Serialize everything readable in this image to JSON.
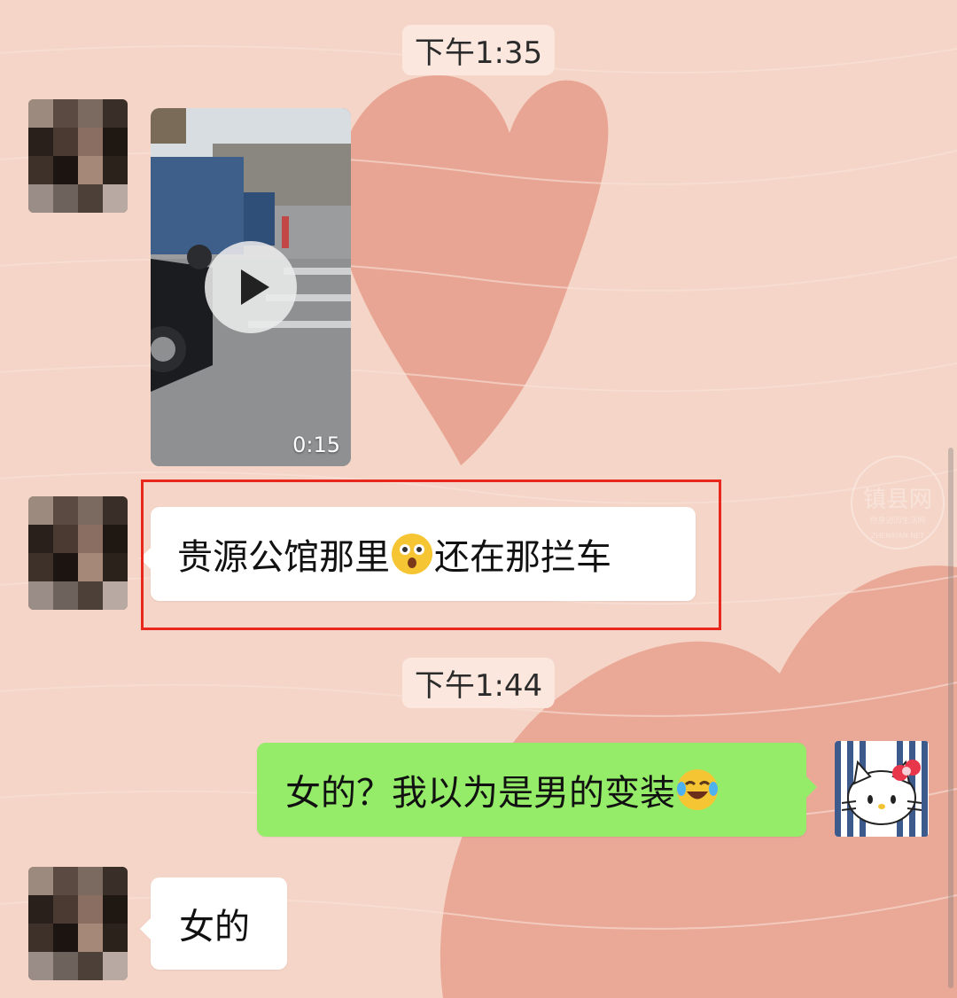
{
  "timestamps": [
    "下午1:35",
    "下午1:44"
  ],
  "video_message": {
    "duration": "0:15",
    "play_icon": "play-icon"
  },
  "messages": [
    {
      "side": "left",
      "text_before": "贵源公馆那里",
      "emoji": "shocked-face-emoji",
      "text_after": "还在那拦车"
    },
    {
      "side": "right",
      "text": "女的？我以为是男的变装",
      "emoji": "tears-of-joy-emoji"
    },
    {
      "side": "left",
      "text": "女的"
    }
  ],
  "watermark": {
    "title": "镇县网",
    "subtitle": "你身边的生活网",
    "footer": "ZHENXIAN.NET"
  },
  "avatars": {
    "contact": "pixelated-avatar",
    "self": "hello-kitty-avatar"
  },
  "colors": {
    "background": "#f5d5c7",
    "heart": "#e8a08e",
    "incoming_bubble": "#ffffff",
    "outgoing_bubble": "#95ec69",
    "highlight_border": "#e8281c"
  }
}
